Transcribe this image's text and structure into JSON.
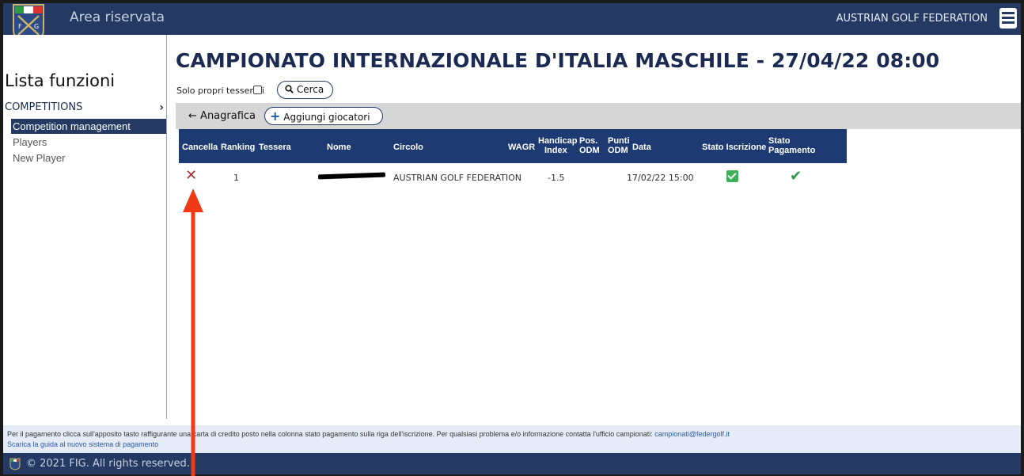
{
  "header": {
    "app_title": "Area riservata",
    "org_name": "AUSTRIAN GOLF FEDERATION"
  },
  "sidebar": {
    "title": "Lista funzioni",
    "section": "COMPETITIONS",
    "items": [
      {
        "label": "Competition management",
        "active": true
      },
      {
        "label": "Players",
        "active": false
      },
      {
        "label": "New Player",
        "active": false
      }
    ]
  },
  "main": {
    "title": "CAMPIONATO INTERNAZIONALE D'ITALIA MASCHILE - 27/04/22 08:00",
    "filter_label": "Solo propri tesserati",
    "search_label": "Cerca",
    "back_label": "Anagrafica",
    "add_label": "Aggiungi giocatori"
  },
  "table": {
    "columns": {
      "cancella": "Cancella",
      "ranking": "Ranking",
      "tessera": "Tessera",
      "nome": "Nome",
      "circolo": "Circolo",
      "wagr": "WAGR",
      "handicap_1": "Handicap",
      "handicap_2": "Index",
      "pos_1": "Pos.",
      "pos_2": "ODM",
      "punti_1": "Punti",
      "punti_2": "ODM",
      "data": "Data",
      "stato_iscrizione": "Stato Iscrizione",
      "stato_pag_1": "Stato",
      "stato_pag_2": "Pagamento"
    },
    "rows": [
      {
        "ranking": "1",
        "tessera": "",
        "nome": "[redacted]",
        "circolo": "AUSTRIAN GOLF FEDERATION",
        "wagr": "",
        "handicap": "-1.5",
        "data": "17/02/22 15:00"
      }
    ]
  },
  "footer": {
    "info_text": "Per il pagamento clicca sull'apposito tasto raffigurante una carta di credito posto nella colonna stato pagamento sulla riga dell'iscrizione. Per qualsiasi problema e/o informazione contatta l'ufficio campionati: ",
    "email": "campionati@federgolf.it",
    "guide_link": "Scarica la guida al nuovo sistema di pagamento",
    "copyright": "© 2021 FIG. All rights reserved."
  },
  "colors": {
    "brand_navy": "#243a63",
    "table_header": "#1d3a73",
    "cancel_red": "#b03030",
    "success_green": "#3fae5a",
    "annotation_arrow": "#f03a17"
  },
  "icons": [
    "fig-logo-icon",
    "hamburger-menu-icon",
    "chevron-right-icon",
    "search-icon",
    "arrow-left-icon",
    "plus-icon",
    "cancel-x-icon",
    "checkbox-checked-icon",
    "checkmark-icon"
  ]
}
